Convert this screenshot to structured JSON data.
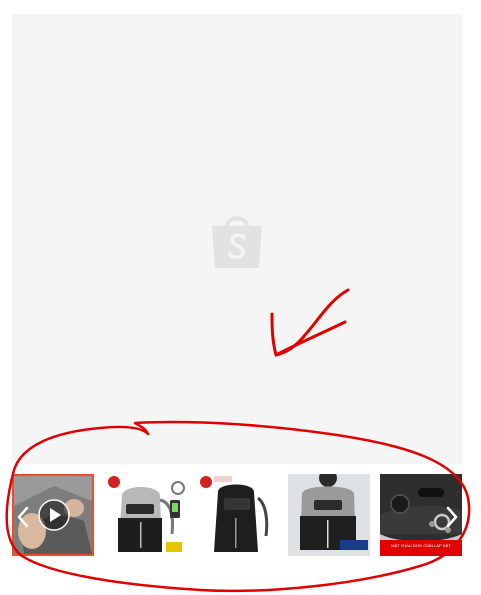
{
  "gallery": {
    "placeholder_icon": "shopee-bag-logo-icon",
    "thumbnails": [
      {
        "name": "thumb-video",
        "kind": "video",
        "icon": "play-icon",
        "active": true
      },
      {
        "name": "thumb-backpack-gray",
        "kind": "image"
      },
      {
        "name": "thumb-backpack-black",
        "kind": "image"
      },
      {
        "name": "thumb-backpack-worn",
        "kind": "image"
      },
      {
        "name": "thumb-lock-closeup",
        "kind": "image",
        "caption": "MẬT KHẨU ĐƠN GIẢN LẮP ĐẶT"
      }
    ],
    "prev_icon": "chevron-left-icon",
    "next_icon": "chevron-right-icon"
  },
  "annotations": {
    "color": "#e00000",
    "marks": [
      "arrow-annotation",
      "circle-annotation"
    ]
  },
  "colors": {
    "accent": "#ee4d2d",
    "placeholder_bg": "#f5f5f5",
    "logo": "#e2e2e2"
  }
}
